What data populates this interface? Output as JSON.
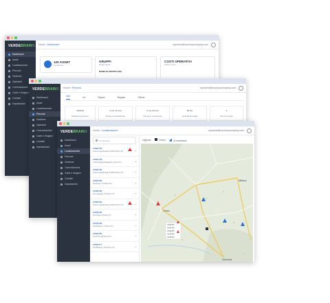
{
  "w1": {
    "brand": "VERDE",
    "brand_accent": "BRAIN",
    "crumbs": [
      "Home",
      "Dashboard"
    ],
    "email": "myname@myshopcompany.com",
    "nav": [
      "Dashboard",
      "Asset",
      "Localizzazione",
      "Percorsi",
      "Gestione",
      "Operatori",
      "Comunicazioni",
      "Carte e rifugium",
      "Contatti",
      "Impostazioni"
    ],
    "cards": [
      {
        "title": "120 ASSET",
        "sub": "Localizzati"
      },
      {
        "title": "GRUPPI",
        "sub": "Raggruppati"
      },
      {
        "title": "COSTI OPERATIVI",
        "sub": "Ultimo mese"
      }
    ],
    "group_line": "NOME DI GRUPPO (08)"
  },
  "w2": {
    "brand": "VERDE",
    "brand_accent": "BRAIN",
    "crumbs": [
      "Home",
      "Percorsi"
    ],
    "email": "myname@myshopcompany.com",
    "nav": [
      "Dashboard",
      "Asset",
      "Localizzazione",
      "Percorsi",
      "Gestione",
      "Operatori",
      "Comunicazioni",
      "Carte e rifugium",
      "Contatti",
      "Impostazioni"
    ],
    "tabs": [
      "Gen",
      "Int",
      "Pigiare",
      "Registri",
      "Offerte"
    ],
    "stats": [
      {
        "v": "120/120",
        "l": "Distanza percorsa"
      },
      {
        "v": "2 ore 11 min",
        "l": "Tempo di conduzione"
      },
      {
        "v": "2 ore 45 min",
        "l": "Tempo in movimento"
      },
      {
        "v": "85 km",
        "l": "Velocità di media"
      },
      {
        "v": "3",
        "l": "Punti di sosta"
      }
    ]
  },
  "w3": {
    "brand": "VERDE",
    "brand_accent": "BRAIN",
    "crumbs": [
      "Home",
      "Localizzazione"
    ],
    "email": "myname@myshopcompany.com",
    "nav": [
      "Dashboard",
      "Asset",
      "Localizzazione",
      "Percorsi",
      "Gestione",
      "Comunicazioni",
      "Carte e rifugium",
      "Contatti",
      "Impostazioni"
    ],
    "search_placeholder": "Cerca asset",
    "legend_title": "Legenda",
    "legend_items": [
      "Fermo",
      "In movimento"
    ],
    "items": [
      {
        "name": "ASSET45",
        "addr": "Corso Luigi Einaudi, 15/100 Torino TO",
        "warn": true
      },
      {
        "name": "ASSET48",
        "addr": "Corso Regina Margherita, Torino TO",
        "warn": false
      },
      {
        "name": "ASSET80",
        "addr": "Corso Luigi Einaudi, 15/100 Torino TO",
        "warn": false
      },
      {
        "name": "ASSET85",
        "addr": "Via Roma, 12 Torino TO",
        "warn": false
      },
      {
        "name": "ASSET95",
        "addr": "Via Lagrange, 60 Torino TO",
        "warn": false
      },
      {
        "name": "ASSET92",
        "addr": "Corso Luigi Einaudi, 15/100 Torino TO",
        "warn": true
      },
      {
        "name": "ASSET93",
        "addr": "Via Frejus, 8 Torino TO",
        "warn": false
      },
      {
        "name": "ASSET83",
        "addr": "Via Marenco, 4 Torino TO",
        "warn": false
      },
      {
        "name": "ASSET84",
        "addr": "Via Nizza, 88 Torino TO",
        "warn": false
      },
      {
        "name": "ASSET77",
        "addr": "Via Bologna, 220 Torino TO",
        "warn": false
      }
    ],
    "map": {
      "cities": [
        "Milano",
        "Torino",
        "Genova"
      ],
      "popup_lines": [
        "ASSET45",
        "ASSET48",
        "ASSET80",
        "ASSET85",
        "ASSET92"
      ]
    }
  }
}
